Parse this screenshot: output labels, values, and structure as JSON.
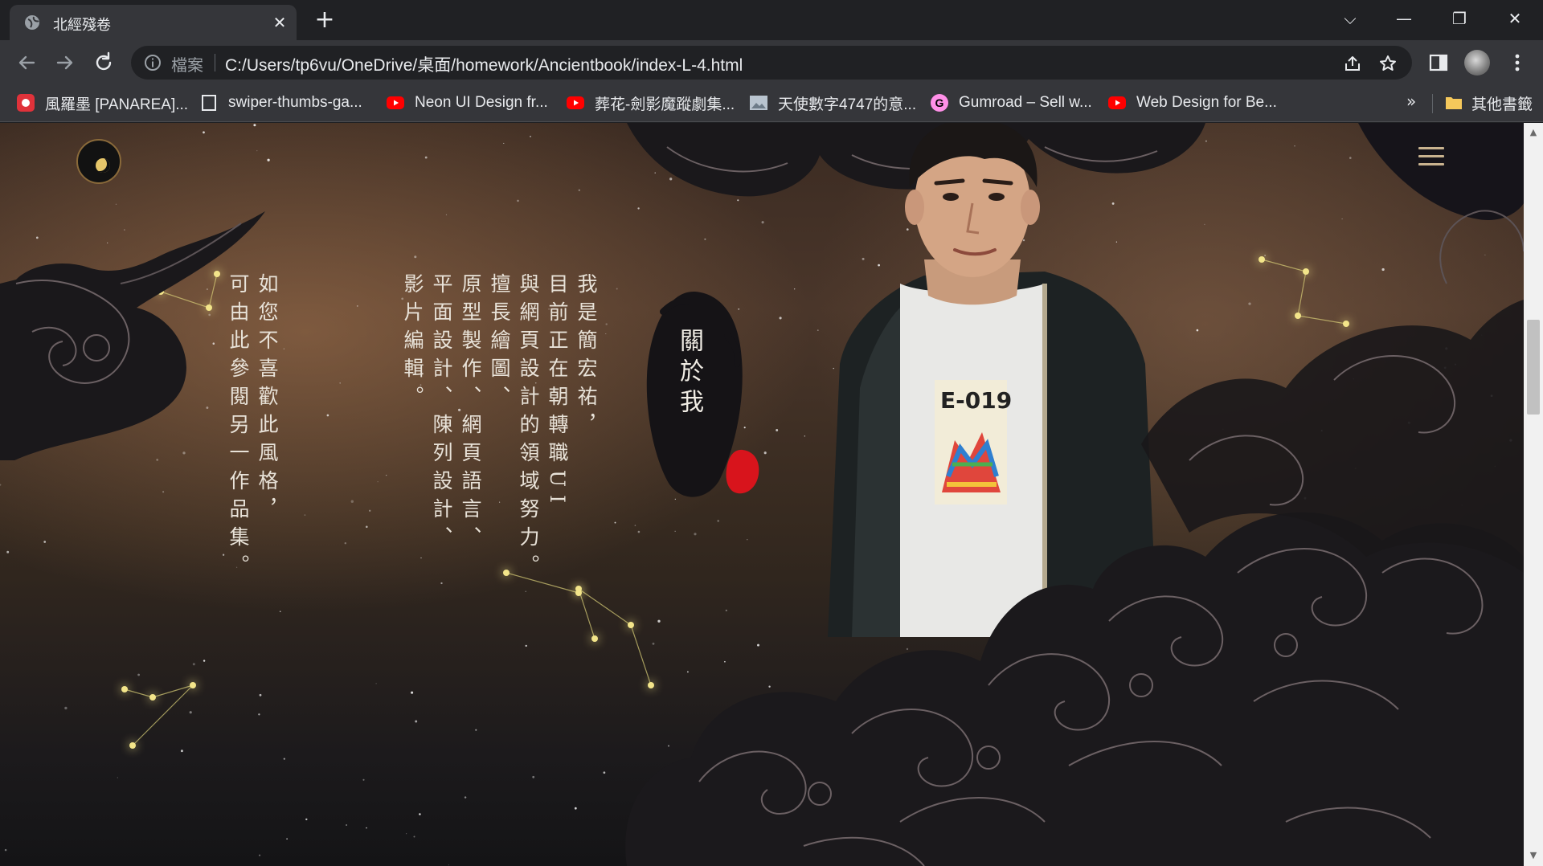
{
  "browser": {
    "tab": {
      "title": "北經殘卷",
      "close": "✕"
    },
    "new_tab": "+",
    "window_controls": {
      "tab_search": "⌵",
      "minimize": "—",
      "restore": "❐",
      "close": "✕"
    },
    "omnibox": {
      "security_chip": "檔案",
      "url": "C:/Users/tp6vu/OneDrive/桌面/homework/Ancientbook/index-L-4.html"
    },
    "bookmarks": [
      {
        "label": "風羅墨 [PANAREA]...",
        "icon": "red-app-icon"
      },
      {
        "label": "swiper-thumbs-ga...",
        "icon": "blank-page-icon"
      },
      {
        "label": "Neon UI Design fr...",
        "icon": "youtube-icon"
      },
      {
        "label": "葬花-劍影魔蹤劇集...",
        "icon": "youtube-icon"
      },
      {
        "label": "天使數字4747的意...",
        "icon": "image-icon"
      },
      {
        "label": "Gumroad – Sell w...",
        "icon": "gumroad-icon"
      },
      {
        "label": "Web Design for Be...",
        "icon": "youtube-icon"
      }
    ],
    "bookmarks_overflow": "»",
    "other_bookmarks": "其他書籤"
  },
  "page": {
    "alt_portfolio_text": "如您不喜歡此風格，可由此參閱另一作品集。",
    "alt_portfolio_lines": [
      "如您不喜歡此風格，",
      "可由此參閱另一作品集。"
    ],
    "intro_lines": [
      "我是簡宏祐，",
      "目前正在朝轉職UI",
      "與網頁設計的領域努力。",
      "擅長繪圖、",
      "原型製作、網頁語言、",
      "平面設計、陳列設計、",
      "影片編輯。"
    ],
    "about_title": "關於我",
    "shirt_text": "E-019"
  },
  "colors": {
    "chrome_dark": "#202124",
    "chrome_mid": "#35363a",
    "text_light": "#e8e2d8",
    "cloud": "#1a181b",
    "cloud_line": "#6b6063",
    "star": "#f3e58a",
    "seal_red": "#d8141c",
    "logo_gold": "#e7c76a"
  }
}
